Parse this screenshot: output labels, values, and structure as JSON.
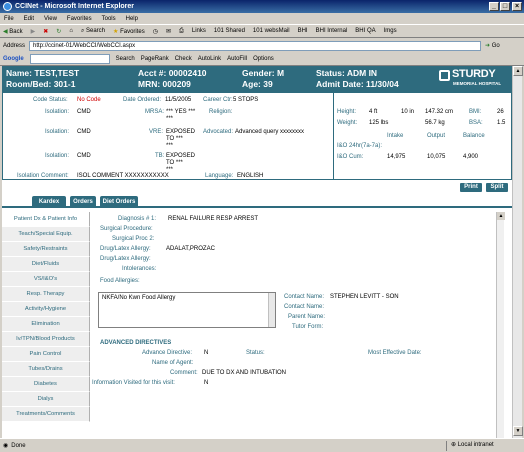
{
  "window": {
    "title": "CCINet - Microsoft Internet Explorer",
    "minimize": "_",
    "maximize": "□",
    "close": "×"
  },
  "menu": [
    "File",
    "Edit",
    "View",
    "Favorites",
    "Tools",
    "Help"
  ],
  "toolbar": {
    "back": "Back",
    "search": "Search",
    "favorites": "Favorites",
    "links_label": "Links",
    "links": [
      "101 Shared",
      "101 websMail",
      "BHI",
      "BHI Internal",
      "BHI QA",
      "Imgs"
    ]
  },
  "address": {
    "label": "Address",
    "url": "http://ccinet-01/WebCCI/WebCCI.aspx",
    "go": "Go"
  },
  "googlebar": {
    "logo": "Google",
    "search": "Search",
    "pagerank": "PageRank",
    "check": "Check",
    "autolink": "AutoLink",
    "autofill": "AutoFill",
    "options": "Options"
  },
  "patient_header": {
    "name": "Name: TEST,TEST",
    "room": "Room/Bed: 301-1",
    "acct": "Acct #: 00002410",
    "mrn": "MRN: 000209",
    "gender": "Gender: M",
    "age": "Age: 39",
    "status": "Status: ADM IN",
    "admit": "Admit Date: 11/30/04",
    "logo_name": "STURDY",
    "logo_sub": "MEMORIAL HOSPITAL"
  },
  "patient_info": {
    "code_status_label": "Code Status:",
    "code_status": "No Code",
    "date_ordered_label": "Date Ordered:",
    "date_ordered": "11/5/2005",
    "career_ctr_label": "Career Ctr:",
    "career_ctr": "5 STOPS",
    "isolation1_label": "Isolation:",
    "isolation1": "CMD",
    "mrsa_label": "MRSA:",
    "mrsa": "*** YES ***",
    "mrsa_to": "***",
    "religion_label": "Religion:",
    "religion": "",
    "isolation2_label": "Isolation:",
    "isolation2": "CMD",
    "vre_label": "VRE:",
    "vre": "EXPOSED",
    "vre_to": "TO ***",
    "vre_extra": "***",
    "advocated_label": "Advocated:",
    "advocated": "Advanced query xxxxxxxx",
    "isolation3_label": "Isolation:",
    "isolation3": "CMD",
    "tb_label": "TB:",
    "tb": "EXPOSED",
    "tb_to": "TO ***",
    "tb_extra": "***",
    "iso_comment_label": "Isolation Comment:",
    "iso_comment": "ISOL COMMENT XXXXXXXXXXX",
    "language_label": "Language:",
    "language": "ENGLISH",
    "height_label": "Height:",
    "height_ft": "4 ft",
    "height_in": "10 in",
    "height_cm": "147.32 cm",
    "bmi_label": "BMI:",
    "bmi": "26",
    "weight_label": "Weight:",
    "weight_lb": "125 lbs",
    "weight_kg": "56.7 kg",
    "bsa_label": "BSA:",
    "bsa": "1.5",
    "intake_label": "Intake",
    "output_label": "Output",
    "balance_label": "Balance",
    "io24_label": "I&O 24hr(7a-7a):",
    "iocum_label": "I&O Cum:",
    "intake_cum": "14,975",
    "output_cum": "10,075",
    "balance_cum": "4,900"
  },
  "actions": {
    "print": "Print",
    "split": "Split"
  },
  "tabs": [
    "Kardex",
    "Orders",
    "Diet Orders"
  ],
  "sidebar": [
    "Patient Dx & Patient Info",
    "Teach/Special Equip.",
    "Safety/Restraints",
    "Diet/Fluids",
    "VS/I&O's",
    "Resp. Therapy",
    "Activity/Hygiene",
    "Elimination",
    "Iv/TPN/Blood Products",
    "Pain Control",
    "Tubes/Drains",
    "Diabetes",
    "Dialys",
    "Treatments/Comments"
  ],
  "details": {
    "diagnosis_label": "Diagnosis # 1:",
    "diagnosis": "RENAL FAILURE RESP ARREST",
    "surgical_label": "Surgical Procedure:",
    "surgical2_label": "Surgical Proc 2:",
    "drug_allergy_label": "Drug/Latex Allergy:",
    "drug_allergy": "ADALAT,PROZAC",
    "drug_allergy2_label": "Drug/Latex Allergy:",
    "intolerances_label": "Intolerances:",
    "food_allergies_label": "Food Allergies:",
    "food_allergies": "NKFA/No Kwn Food Allergy",
    "contact1_label": "Contact Name:",
    "contact1": "STEPHEN LEVITT - SON",
    "contact2_label": "Contact Name:",
    "parent_label": "Parent Name:",
    "tutor_label": "Tutor Form:",
    "adv_heading": "ADVANCED DIRECTIVES",
    "adv_label": "Advance Directive:",
    "adv_value": "N",
    "status_label": "Status:",
    "effective_label": "Most Effective Date:",
    "agent_label": "Name of Agent:",
    "comment_label": "Comment:",
    "comment": "DUE TO DX AND INTUBATION",
    "info_visited_label": "Information Visited for this visit:",
    "info_visited": "N"
  },
  "statusbar": {
    "left": "Done",
    "zone": "Local intranet"
  }
}
